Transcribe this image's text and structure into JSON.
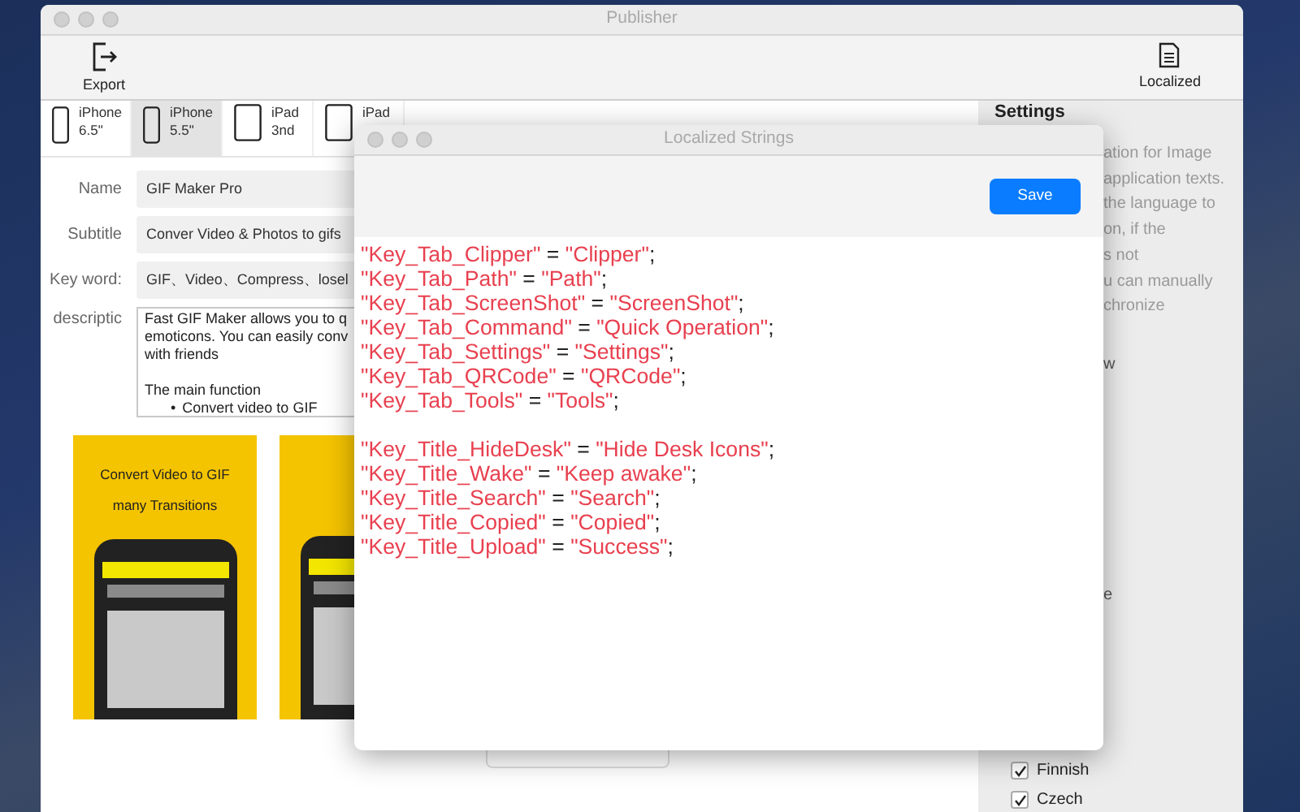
{
  "window": {
    "title": "Publisher"
  },
  "toolbar": [
    {
      "label": "Export",
      "kind": "export"
    },
    {
      "label": "Localized",
      "kind": "document"
    }
  ],
  "device_tabs": [
    {
      "name": "iPhone",
      "size": "6.5\"",
      "kind": "phone",
      "selected": false
    },
    {
      "name": "iPhone",
      "size": "5.5\"",
      "kind": "phone",
      "selected": true
    },
    {
      "name": "iPad",
      "size": "3nd",
      "kind": "tablet",
      "selected": false
    },
    {
      "name": "iPad",
      "kind": "tablet",
      "selected": false
    }
  ],
  "form": {
    "fields": [
      {
        "label": "Name",
        "value": "GIF Maker Pro"
      },
      {
        "label": "Subtitle",
        "value": "Conver Video & Photos to gifs"
      },
      {
        "label": "Key word:",
        "value": "GIF、Video、Compress、losel"
      }
    ],
    "description": {
      "label": "descriptic",
      "lines": [
        "Fast GIF Maker allows you to q",
        "emoticons. You can easily conv",
        "with friends"
      ],
      "heading": "The main function",
      "bullets": [
        {
          "marker": "•",
          "text": "Convert video to GIF"
        }
      ]
    }
  },
  "screenshots": [
    {
      "kind": "yellow",
      "title": "Convert Video to GIF",
      "caption": "many Transitions"
    },
    {
      "kind": "yellow"
    },
    {
      "kind": "blank"
    }
  ],
  "settings": {
    "title": "Settings",
    "text_fragments": [
      "ation for Image",
      "application texts.",
      "the language to",
      "on, if the",
      "s not",
      "u can manually",
      "chronize"
    ],
    "lower_fragments": [
      "w",
      "e"
    ],
    "languages": [
      {
        "label": "Finnish",
        "checked": true
      },
      {
        "label": "Czech",
        "checked": true
      }
    ]
  },
  "dialog": {
    "title": "Localized Strings",
    "save": "Save",
    "groups": [
      [
        {
          "key": "\"Key_Tab_Clipper\"",
          "op": "=",
          "value": "\"Clipper\"",
          "end": ";"
        },
        {
          "key": "\"Key_Tab_Path\"",
          "op": "=",
          "value": "\"Path\"",
          "end": ";"
        },
        {
          "key": "\"Key_Tab_ScreenShot\"",
          "op": "=",
          "value": "\"ScreenShot\"",
          "end": ";"
        },
        {
          "key": "\"Key_Tab_Command\"",
          "op": "=",
          "value": "\"Quick Operation\"",
          "end": ";"
        },
        {
          "key": "\"Key_Tab_Settings\"",
          "op": "=",
          "value": "\"Settings\"",
          "end": ";"
        },
        {
          "key": "\"Key_Tab_QRCode\"",
          "op": "=",
          "value": "\"QRCode\"",
          "end": ";"
        },
        {
          "key": "\"Key_Tab_Tools\"",
          "op": "=",
          "value": "\"Tools\"",
          "end": ";"
        }
      ],
      [
        {
          "key": "\"Key_Title_HideDesk\"",
          "op": "=",
          "value": "\"Hide Desk Icons\"",
          "end": ";"
        },
        {
          "key": "\"Key_Title_Wake\"",
          "op": "=",
          "value": "\"Keep awake\"",
          "end": ";"
        },
        {
          "key": "\"Key_Title_Search\"",
          "op": "=",
          "value": "\"Search\"",
          "end": ";"
        },
        {
          "key": "\"Key_Title_Copied\"",
          "op": "=",
          "value": "\"Copied\"",
          "end": ";"
        },
        {
          "key": "\"Key_Title_Upload\"",
          "op": "=",
          "value": "\"Success\"",
          "end": ";"
        }
      ]
    ]
  }
}
